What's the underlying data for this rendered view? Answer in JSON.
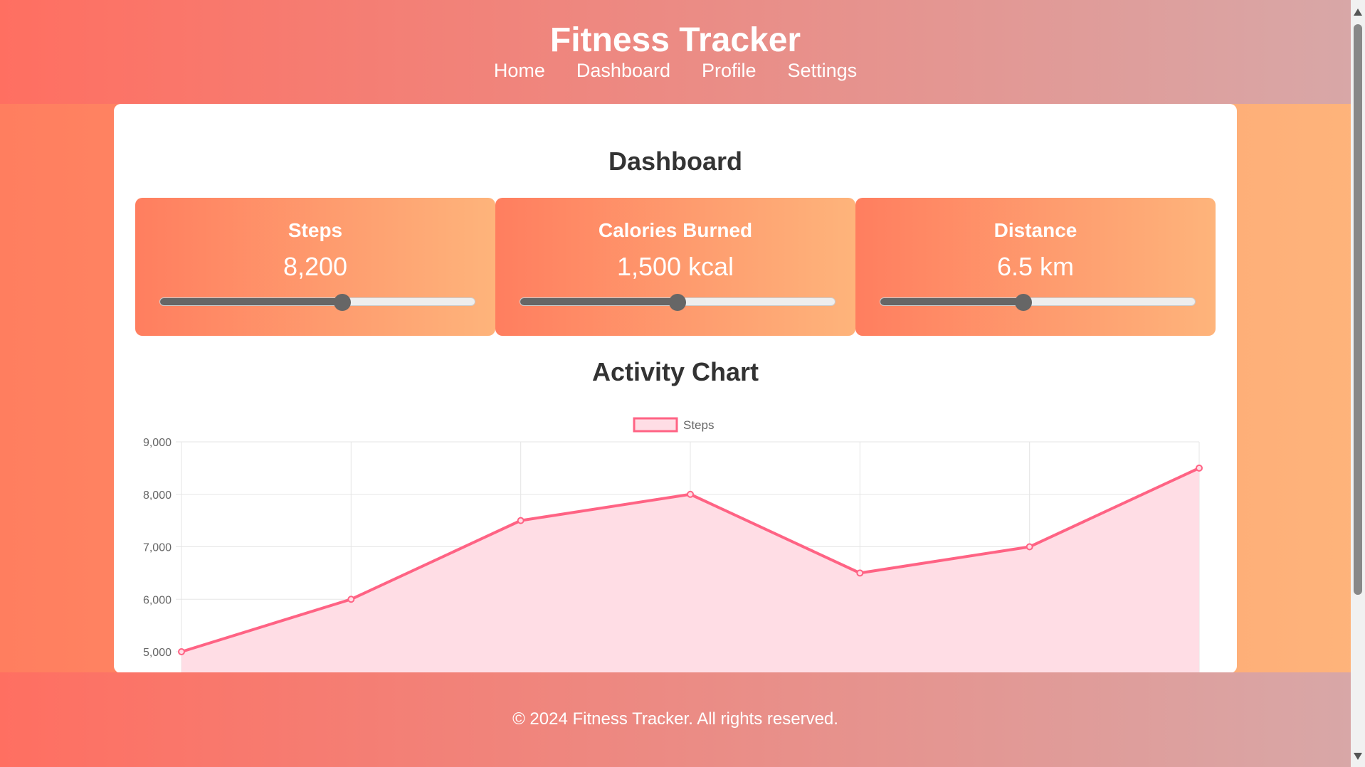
{
  "header": {
    "title": "Fitness Tracker",
    "nav": [
      "Home",
      "Dashboard",
      "Profile",
      "Settings"
    ]
  },
  "dashboard": {
    "title": "Dashboard",
    "cards": [
      {
        "title": "Steps",
        "value": "8,200",
        "slider_fraction": 0.58
      },
      {
        "title": "Calories Burned",
        "value": "1,500 kcal",
        "slider_fraction": 0.5
      },
      {
        "title": "Distance",
        "value": "6.5 km",
        "slider_fraction": 0.455
      }
    ]
  },
  "chart_title": "Activity Chart",
  "chart_data": {
    "type": "area",
    "series": [
      {
        "name": "Steps",
        "values": [
          5000,
          6000,
          7500,
          8000,
          6500,
          7000,
          8500
        ],
        "color": "#ff6384"
      }
    ],
    "ylim": [
      5000,
      9000
    ],
    "yticks": [
      "9,000",
      "8,000",
      "7,000",
      "6,000",
      "5,000"
    ],
    "ytick_values": [
      9000,
      8000,
      7000,
      6000,
      5000
    ],
    "grid": true,
    "legend": "top-center"
  },
  "footer": {
    "text": "© 2024 Fitness Tracker. All rights reserved."
  },
  "colors": {
    "accent": "#ff6384",
    "fill": "#ffdde5",
    "header_start": "#ff6f61",
    "header_end": "#d8a7a7"
  }
}
